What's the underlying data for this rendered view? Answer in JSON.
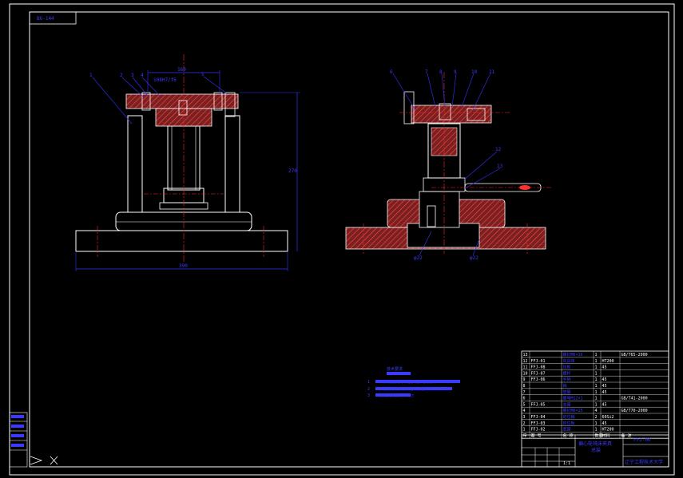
{
  "drawing": {
    "code": "BG-144",
    "company": "辽宁工程技术大学",
    "title_block_drawing_no": "FFJ-00",
    "title_block_name": "偏心轮铣床夹具",
    "title_block_name_line2": "总装",
    "scale_note": "1:1"
  },
  "colors": {
    "line": "#ffffff",
    "dimension": "#3333ff",
    "center": "#ff2020",
    "hatch": "#ff3a3a",
    "part_fill": "#8a2a2a",
    "frame": "#ffffff"
  },
  "dimensions": {
    "front_width": "390",
    "front_height": "270",
    "front_top": "160",
    "front_top_b": "108H7/f6",
    "side_a": "φ22",
    "side_b": "φ22"
  },
  "balloons": {
    "front": [
      "1",
      "2",
      "3",
      "4",
      "5"
    ],
    "side": [
      "6",
      "7",
      "8",
      "9",
      "10",
      "11",
      "12",
      "13"
    ]
  },
  "notes": {
    "heading": "技术要求",
    "lines": [
      "1. 夹具装配后各零件连接可靠，定位准确",
      "2. 夹紧机构动作灵活，无卡滞现象",
      "3. 未注明公差按IT12加工"
    ]
  },
  "bom": {
    "rows": [
      {
        "no": "13",
        "code": "",
        "name": "螺钉M6×16",
        "qty": "1",
        "mat": "",
        "note": "GB/T65-2000"
      },
      {
        "no": "12",
        "code": "FFJ-01",
        "name": "夹具体",
        "qty": "1",
        "mat": "HT200",
        "note": ""
      },
      {
        "no": "11",
        "code": "FFJ-08",
        "name": "压板",
        "qty": "1",
        "mat": "45",
        "note": ""
      },
      {
        "no": "10",
        "code": "FFJ-07",
        "name": "螺杆",
        "qty": "1",
        "mat": "",
        "note": ""
      },
      {
        "no": "9",
        "code": "FFJ-06",
        "name": "手柄",
        "qty": "1",
        "mat": "45",
        "note": ""
      },
      {
        "no": "8",
        "code": "",
        "name": "销",
        "qty": "1",
        "mat": "45",
        "note": ""
      },
      {
        "no": "7",
        "code": "",
        "name": "垫圈",
        "qty": "1",
        "mat": "45",
        "note": ""
      },
      {
        "no": "6",
        "code": "",
        "name": "螺母M12×1",
        "qty": "1",
        "mat": "",
        "note": "GB/T41-2000"
      },
      {
        "no": "5",
        "code": "FFJ-05",
        "name": "支座",
        "qty": "1",
        "mat": "45",
        "note": ""
      },
      {
        "no": "4",
        "code": "",
        "name": "螺钉M6×25",
        "qty": "4",
        "mat": "",
        "note": "GB/T70-2000"
      },
      {
        "no": "3",
        "code": "FFJ-04",
        "name": "定位销",
        "qty": "2",
        "mat": "60Si2",
        "note": ""
      },
      {
        "no": "2",
        "code": "FFJ-03",
        "name": "定位板",
        "qty": "1",
        "mat": "45",
        "note": ""
      },
      {
        "no": "1",
        "code": "FFJ-02",
        "name": "底座",
        "qty": "1",
        "mat": "HT200",
        "note": ""
      }
    ],
    "header": {
      "no": "序",
      "code": "图 号",
      "name": "名 称",
      "qty": "数量",
      "mat": "材料",
      "note": "备 注"
    }
  }
}
